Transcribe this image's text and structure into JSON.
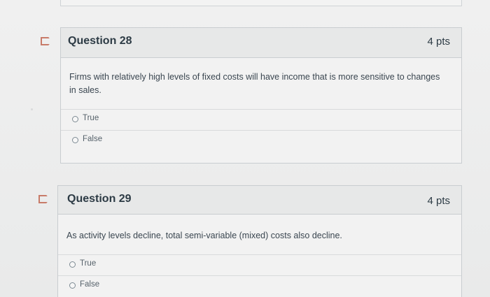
{
  "questions": [
    {
      "title": "Question 28",
      "points": "4 pts",
      "text": "Firms with relatively high levels of fixed costs will have income that is more sensitive to changes in sales.",
      "options": [
        "True",
        "False"
      ]
    },
    {
      "title": "Question 29",
      "points": "4 pts",
      "text": "As activity levels decline, total semi-variable (mixed) costs also decline.",
      "options": [
        "True",
        "False"
      ]
    }
  ],
  "colors": {
    "flag": "#c87b69",
    "card": "#f2f2f2",
    "border": "#c9cdd0"
  }
}
